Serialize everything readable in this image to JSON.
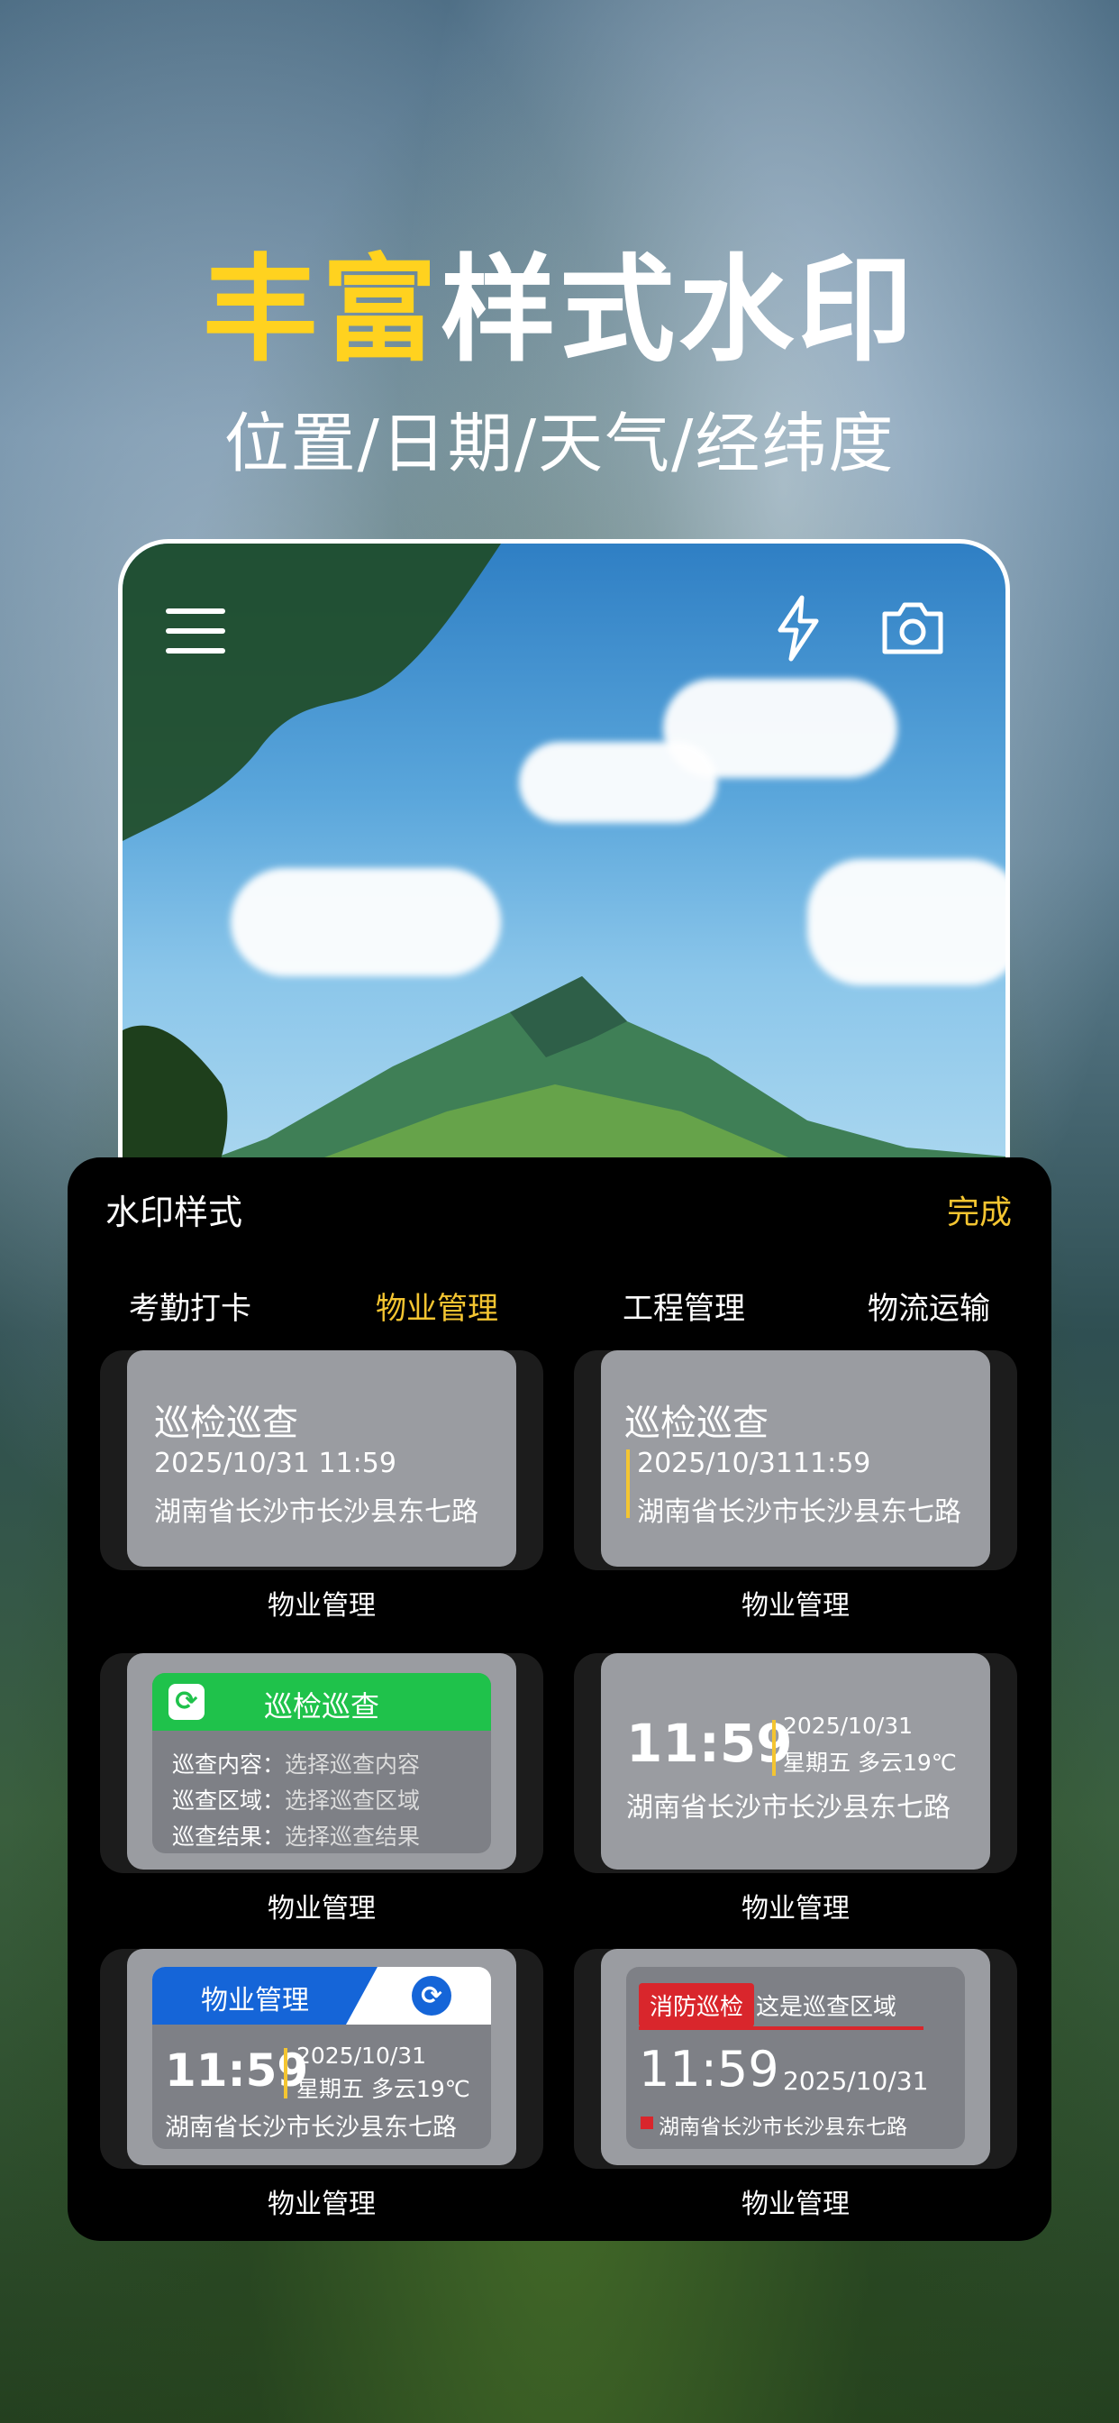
{
  "hero": {
    "title_highlight": "丰富",
    "title_rest": "样式水印",
    "subtitle": "位置/日期/天气/经纬度"
  },
  "camera": {
    "icons": [
      "menu-icon",
      "flash-icon",
      "camera-icon"
    ]
  },
  "sheet": {
    "title": "水印样式",
    "done": "完成",
    "tabs": [
      "考勤打卡",
      "物业管理",
      "工程管理",
      "物流运输"
    ],
    "active_tab_index": 1
  },
  "cards": [
    {
      "label": "物业管理",
      "title": "巡检巡查",
      "datetime": "2025/10/31 11:59",
      "address": "湖南省长沙市长沙县东七路"
    },
    {
      "label": "物业管理",
      "title": "巡检巡查",
      "datetime": "2025/10/3111:59",
      "address": "湖南省长沙市长沙县东七路"
    },
    {
      "label": "物业管理",
      "header": "巡检巡查",
      "rows": [
        {
          "k": "巡查内容：",
          "v": "选择巡查内容"
        },
        {
          "k": "巡查区域：",
          "v": "选择巡查区域"
        },
        {
          "k": "巡查结果：",
          "v": "选择巡查结果"
        }
      ]
    },
    {
      "label": "物业管理",
      "time": "11:59",
      "date": "2025/10/31",
      "weather": "星期五  多云19℃",
      "address": "湖南省长沙市长沙县东七路"
    },
    {
      "label": "物业管理",
      "header": "物业管理",
      "time": "11:59",
      "date": "2025/10/31",
      "weather": "星期五  多云19℃",
      "address": "湖南省长沙市长沙县东七路"
    },
    {
      "label": "物业管理",
      "tag": "消防巡检",
      "area": "这是巡查区域",
      "time": "11:59",
      "date": "2025/10/31",
      "address": "湖南省长沙市长沙县东七路"
    }
  ],
  "colors": {
    "accent": "#f4c531",
    "green": "#1fc24b",
    "blue": "#1565d8",
    "red": "#d9262c"
  }
}
